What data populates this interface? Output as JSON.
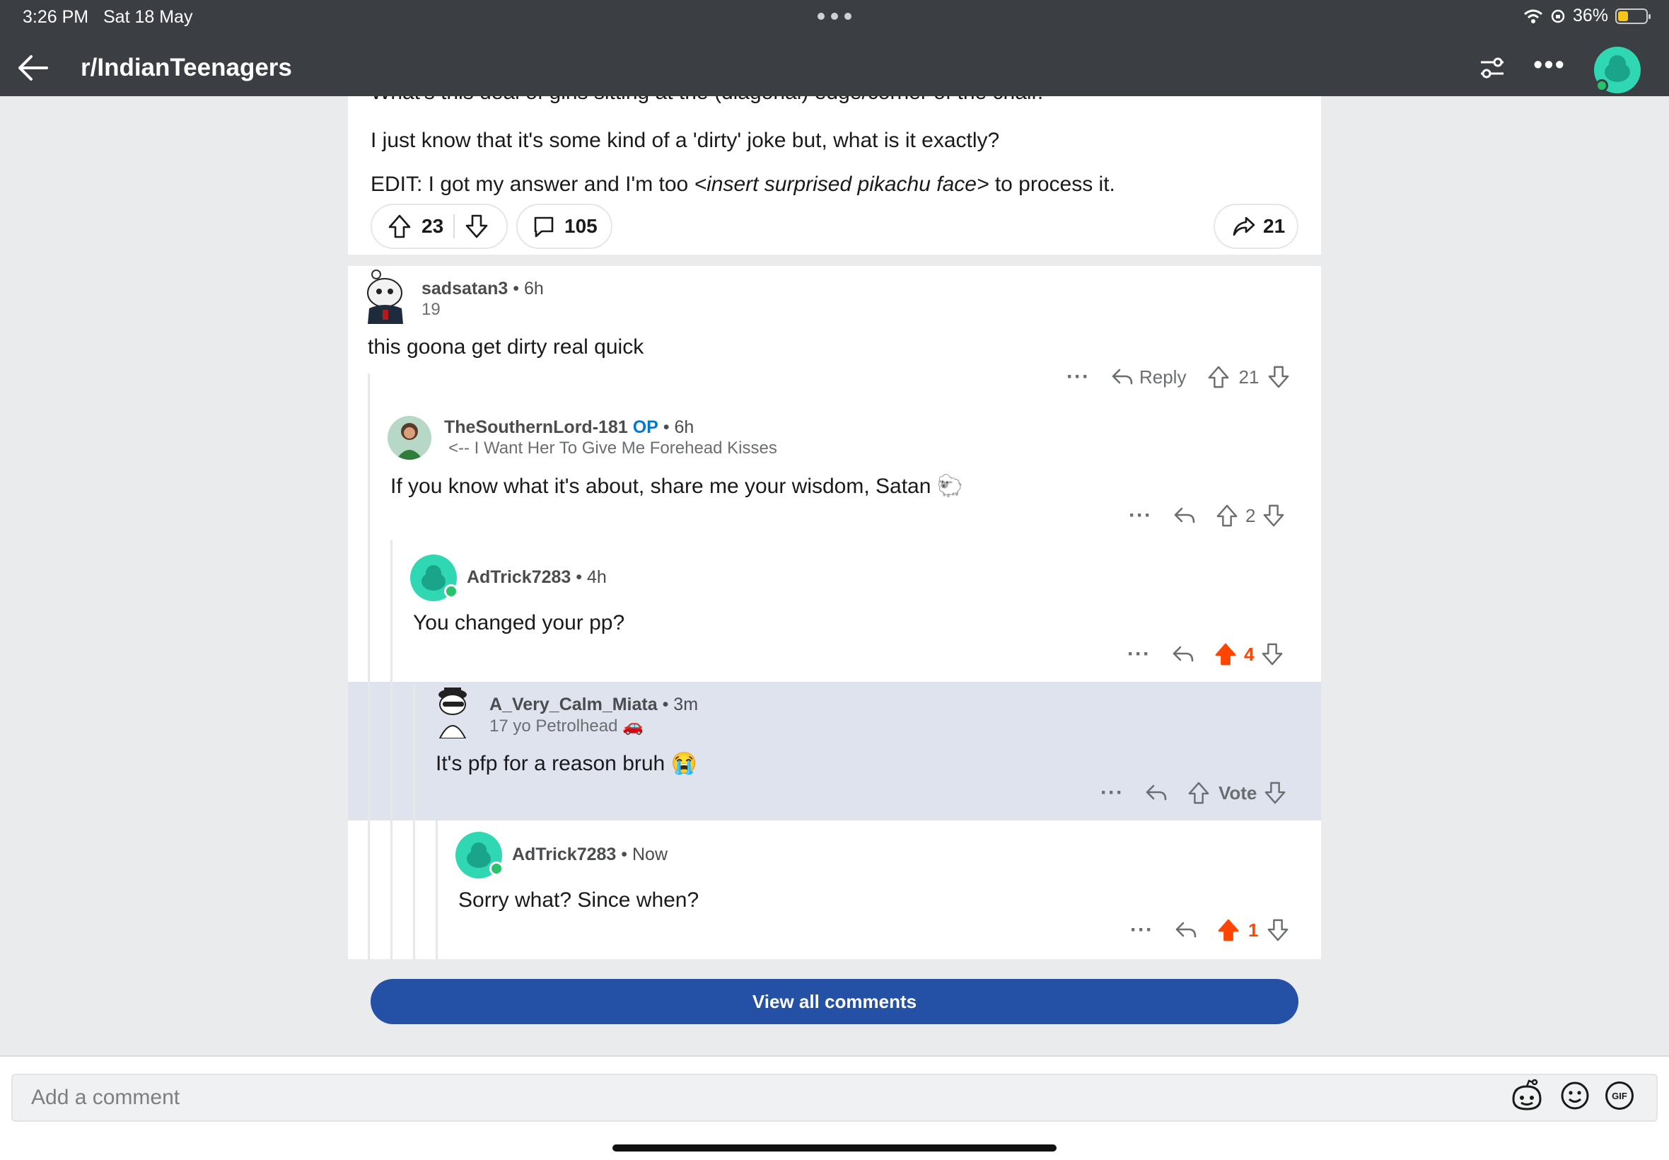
{
  "status_bar": {
    "time": "3:26 PM",
    "date": "Sat 18 May",
    "battery": "36%",
    "battery_level": 0.36
  },
  "nav": {
    "subreddit": "r/IndianTeenagers"
  },
  "post": {
    "cut_line": "What's this deal of girls sitting at the (diagonal) edge/corner of the chair.",
    "line1": "I just know that it's some kind of a 'dirty' joke but, what is it exactly?",
    "line2_prefix": "EDIT: I got my answer and I'm too ",
    "line2_italic": "<insert surprised pikachu face>",
    "line2_suffix": " to process it.",
    "votes": "23",
    "comments": "105",
    "shares": "21"
  },
  "comments": [
    {
      "user": "sadsatan3",
      "time": "6h",
      "flair": "19",
      "body": "this goona get dirty real quick",
      "reply_label": "Reply",
      "score": "21"
    },
    {
      "user": "TheSouthernLord-181",
      "op": "OP",
      "time": "6h",
      "flair": "<-- I Want Her To Give Me Forehead Kisses",
      "body": "If you know what it's about, share me your wisdom, Satan 🐑",
      "score": "2"
    },
    {
      "user": "AdTrick7283",
      "time": "4h",
      "body": "You changed your pp?",
      "score": "4"
    },
    {
      "user": "A_Very_Calm_Miata",
      "time": "3m",
      "flair": "17 yo Petrolhead 🚗",
      "body": "It's pfp for a reason bruh 😭",
      "score": "Vote"
    },
    {
      "user": "AdTrick7283",
      "time": "Now",
      "body": "Sorry what? Since when?",
      "score": "1"
    }
  ],
  "view_all": "View all comments",
  "composer": {
    "placeholder": "Add a comment",
    "gif_label": "GIF"
  },
  "colors": {
    "header": "#3b3e42",
    "upvote": "#ff4500",
    "op": "#0079d3",
    "button": "#2450a6",
    "highlight": "#dfe3ee"
  }
}
